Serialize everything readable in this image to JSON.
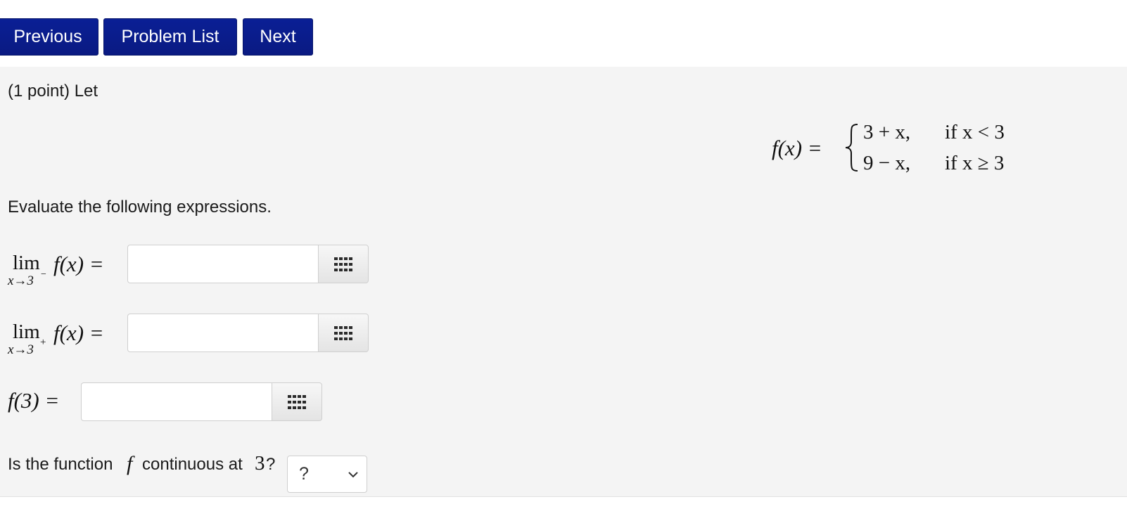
{
  "nav": {
    "previous_label": "Previous",
    "problem_list_label": "Problem List",
    "next_label": "Next",
    "button_color": "#0a1a82"
  },
  "problem": {
    "intro": "(1 point) Let",
    "function_lhs": "f(x) =",
    "cases": [
      {
        "expr": "3 + x,",
        "cond": "if x < 3"
      },
      {
        "expr": "9 − x,",
        "cond": "if x ≥ 3"
      }
    ],
    "instruction": "Evaluate the following expressions.",
    "answers": [
      {
        "label_lim": "lim",
        "label_func": "f(x) =",
        "subscript": "x→3",
        "superscript": "−",
        "value": ""
      },
      {
        "label_lim": "lim",
        "label_func": "f(x) =",
        "subscript": "x→3",
        "superscript": "+",
        "value": ""
      },
      {
        "label_func": "f(3) =",
        "value": ""
      }
    ],
    "continuity_question_prefix": "Is the function",
    "continuity_question_f": "f",
    "continuity_question_mid": "continuous at",
    "continuity_question_point": "3",
    "continuity_question_suffix": "?",
    "continuity_select_value": "?",
    "palette_icon": "grid-icon"
  }
}
